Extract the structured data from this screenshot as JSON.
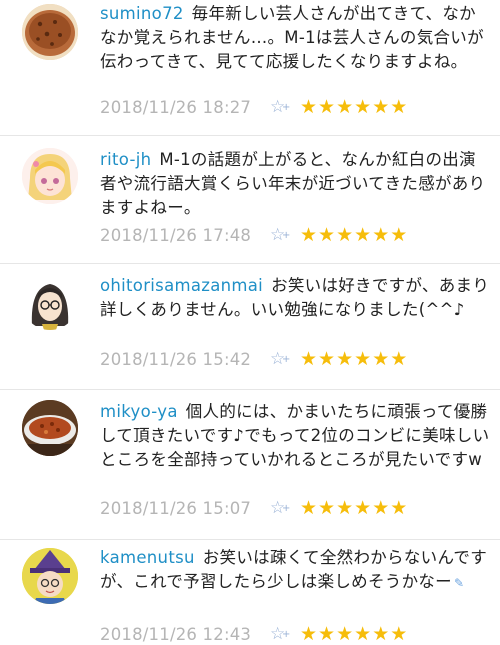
{
  "comments": [
    {
      "username": "sumino72",
      "text": "毎年新しい芸人さんが出てきて、なかなか覚えられません…。M-1は芸人さんの気合いが伝わってきて、見てて応援したくなりますよね。",
      "timestamp": "2018/11/26 18:27",
      "rating": 6,
      "avatar": "bread-avatar"
    },
    {
      "username": "rito-jh",
      "text": "M-1の話題が上がると、なんか紅白の出演者や流行語大賞くらい年末が近づいてきた感がありますよねー。",
      "timestamp": "2018/11/26 17:48",
      "rating": 6,
      "avatar": "anime-girl-avatar"
    },
    {
      "username": "ohitorisamazanmai",
      "text": "お笑いは好きですが、あまり詳しくありません。いい勉強になりました(^^♪",
      "timestamp": "2018/11/26 15:42",
      "rating": 6,
      "avatar": "glasses-character-avatar"
    },
    {
      "username": "mikyo-ya",
      "text": "個人的には、かまいたちに頑張って優勝して頂きたいです♪でもって2位のコンビに美味しいところを全部持っていかれるところが見たいですw",
      "timestamp": "2018/11/26 15:07",
      "rating": 6,
      "avatar": "food-avatar"
    },
    {
      "username": "kamenutsu",
      "text": "お笑いは疎くて全然わからないんですが、これで予習したら少しは楽しめそうかなー",
      "timestamp": "2018/11/26 12:43",
      "rating": 6,
      "avatar": "witch-character-avatar"
    }
  ],
  "icons": {
    "favorite": "star-plus-icon",
    "rating_star": "star-icon",
    "edit": "pen-icon"
  },
  "colors": {
    "username": "#1f8fc6",
    "star": "#f6bd0b",
    "timestamp": "#b5b5b5",
    "favorite_icon": "#9ab2d6"
  }
}
